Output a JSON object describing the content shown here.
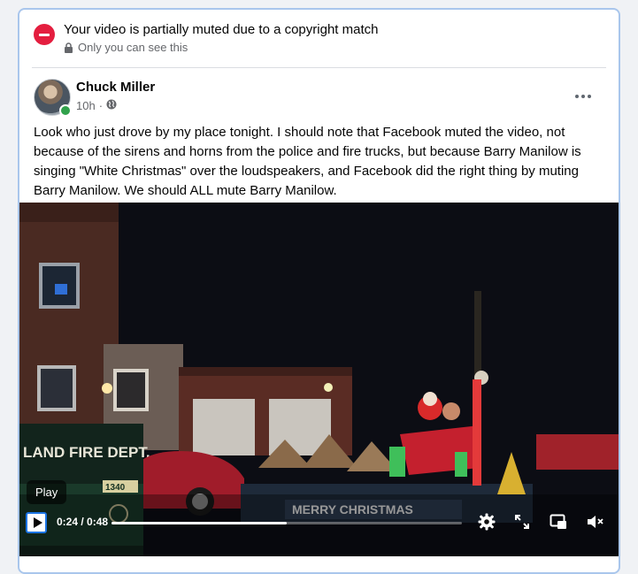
{
  "notice": {
    "title": "Your video is partially muted due to a copyright match",
    "subtitle": "Only you can see this"
  },
  "post": {
    "author": "Chuck Miller",
    "time": "10h",
    "separator": "·",
    "text": "Look who just drove by my place tonight.  I should note that Facebook muted the video, not because of the sirens and horns from the police and fire trucks, but because Barry Manilow is singing \"White Christmas\" over the loudspeakers, and Facebook did the right thing by muting Barry Manilow.  We should ALL mute Barry Manilow."
  },
  "video": {
    "truck_sign": "LAND FIRE DEPT.",
    "truck_number": "1340",
    "float_banner": "MERRY CHRISTMAS",
    "tooltip": "Play",
    "current_time": "0:24",
    "time_separator": " / ",
    "duration": "0:48",
    "progress": 0.5
  },
  "colors": {
    "accent": "#1b74e4",
    "danger": "#e41e3f",
    "online": "#31a24c"
  }
}
